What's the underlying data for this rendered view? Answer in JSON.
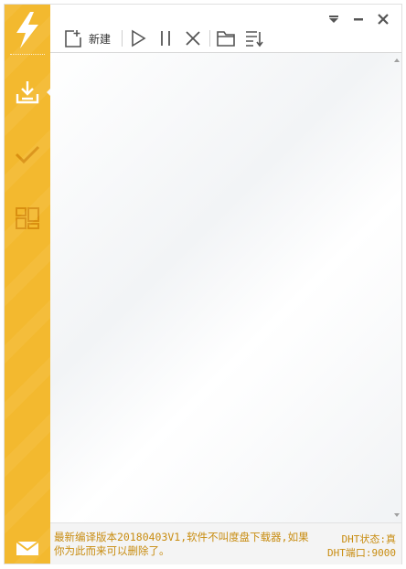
{
  "colors": {
    "sidebar": "#f3b92f",
    "accent_text": "#c88c10",
    "icon": "#555555"
  },
  "sidebar": {
    "logo_icon": "lightning-bolt-icon",
    "items": [
      {
        "name": "downloading",
        "icon": "download-tray-icon",
        "active": true
      },
      {
        "name": "completed",
        "icon": "checkmark-icon",
        "active": false
      },
      {
        "name": "apps",
        "icon": "grid-panels-icon",
        "active": false
      }
    ],
    "mail_icon": "envelope-icon"
  },
  "toolbar": {
    "new_label": "新建",
    "buttons": [
      "new-task-icon",
      "start-icon",
      "pause-icon",
      "delete-icon",
      "open-folder-icon",
      "sort-icon"
    ]
  },
  "window_controls": [
    "dropdown-menu-icon",
    "minimize-icon",
    "close-icon"
  ],
  "status": {
    "notice": "最新编译版本20180403V1,软件不叫度盘下载器,如果你为此而来可以删除了。",
    "dht_status": "DHT状态:真",
    "dht_port": "DHT端口:9000"
  }
}
